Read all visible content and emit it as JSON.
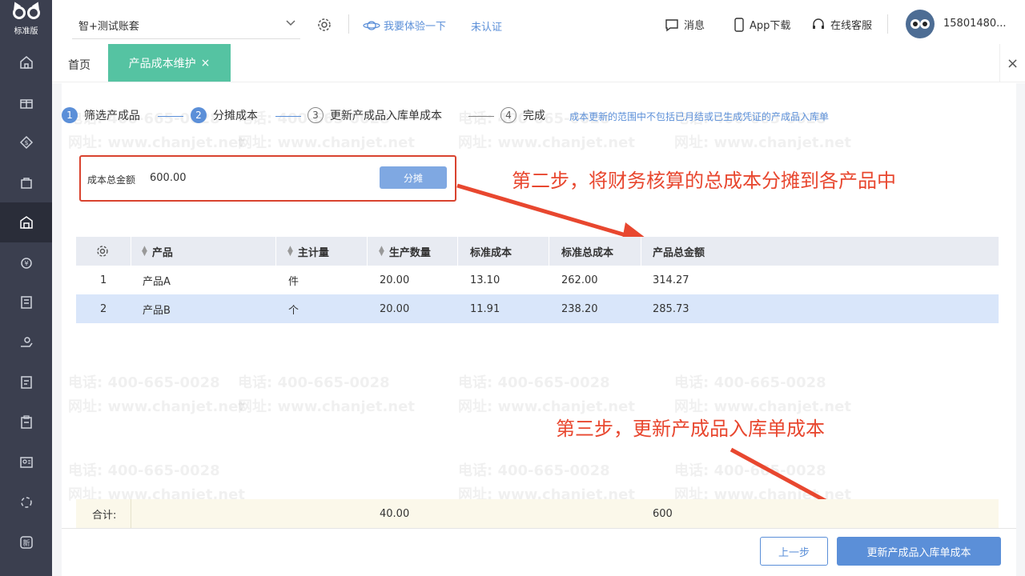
{
  "logo": {
    "brand": "标准版"
  },
  "header": {
    "account": "智+测试账套",
    "trial": "我要体验一下",
    "uncertified": "未认证",
    "messages": "消息",
    "app_download": "App下载",
    "online_service": "在线客服",
    "user": "15801480..."
  },
  "tabs": {
    "home": "首页",
    "active": "产品成本维护",
    "active_close": "×",
    "close_all": "×"
  },
  "steps": [
    {
      "num": "1",
      "label": "筛选产成品"
    },
    {
      "num": "2",
      "label": "分摊成本"
    },
    {
      "num": "3",
      "label": "更新产成品入库单成本"
    },
    {
      "num": "4",
      "label": "完成"
    }
  ],
  "step_note": "成本更新的范围中不包括已月结或已生成凭证的产成品入库单",
  "cost": {
    "label": "成本总金额",
    "value": "600.00",
    "allocate_button": "分摊"
  },
  "annotations": {
    "step2": "第二步，将财务核算的总成本分摊到各产品中",
    "step3": "第三步，更新产成品入库单成本"
  },
  "table": {
    "columns": [
      "产品",
      "主计量",
      "生产数量",
      "标准成本",
      "标准总成本",
      "产品总金额"
    ],
    "rows": [
      {
        "idx": "1",
        "product": "产品A",
        "unit": "件",
        "qty": "20.00",
        "std_cost": "13.10",
        "std_total": "262.00",
        "amount": "314.27"
      },
      {
        "idx": "2",
        "product": "产品B",
        "unit": "个",
        "qty": "20.00",
        "std_cost": "11.91",
        "std_total": "238.20",
        "amount": "285.73"
      }
    ],
    "total": {
      "label": "合计:",
      "qty": "40.00",
      "amount": "600"
    }
  },
  "footer": {
    "prev_button": "上一步",
    "update_button": "更新产成品入库单成本"
  },
  "watermark": {
    "phone": "电话: 400-665-0028",
    "site": "网址: www.chanjet.net"
  },
  "colors": {
    "accent": "#5b8fd8",
    "tab_active": "#55c3a2",
    "annotation": "#e8472f",
    "sidebar": "#3b3f4f"
  }
}
